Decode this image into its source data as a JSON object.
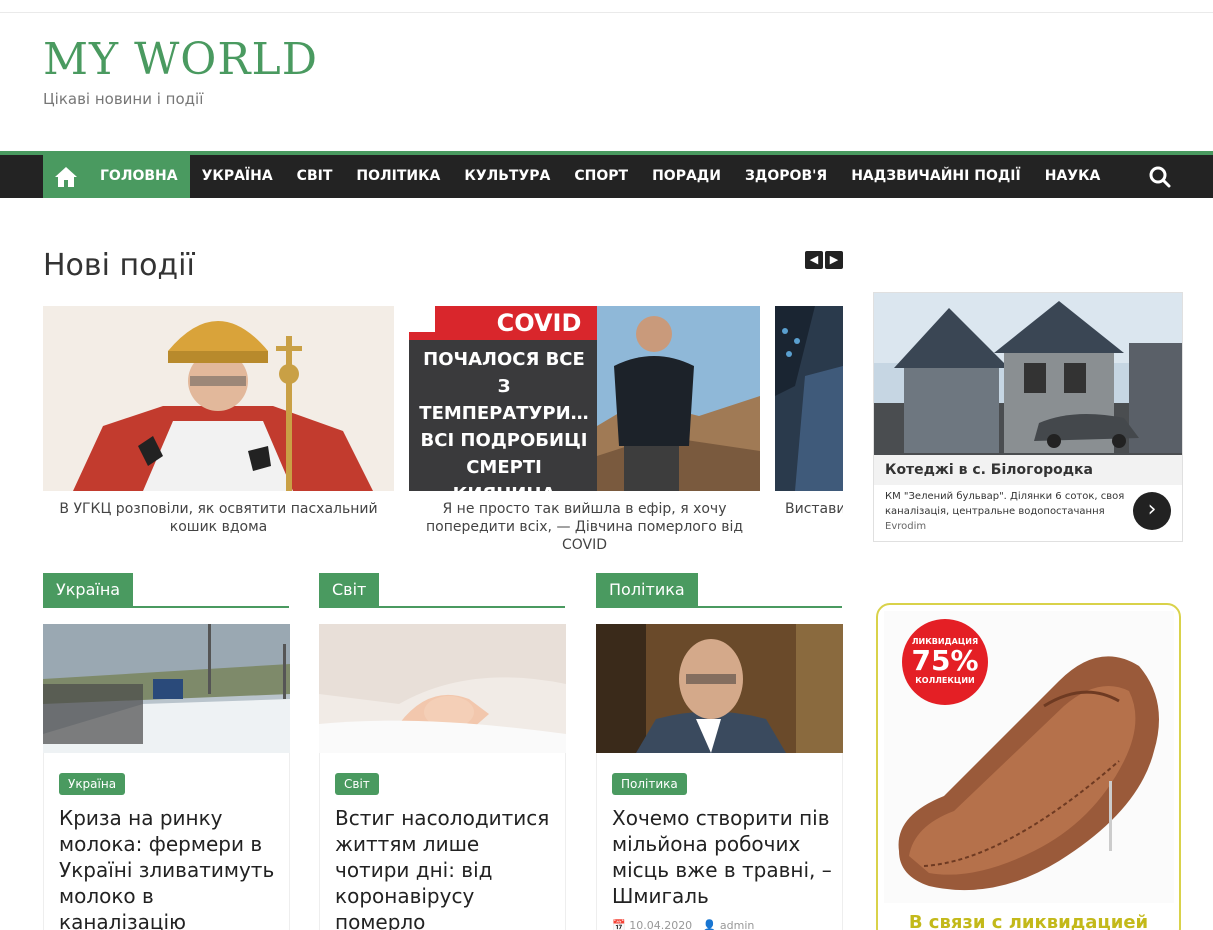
{
  "site": {
    "title": "MY WORLD",
    "description": "Цікаві новини і події"
  },
  "nav": {
    "items": [
      {
        "label": "ГОЛОВНА",
        "active": true
      },
      {
        "label": "УКРАЇНА"
      },
      {
        "label": "СВІТ"
      },
      {
        "label": "ПОЛІТИКА"
      },
      {
        "label": "КУЛЬТУРА"
      },
      {
        "label": "СПОРТ"
      },
      {
        "label": "ПОРАДИ"
      },
      {
        "label": "ЗДОРОВ'Я"
      },
      {
        "label": "НАДЗВИЧАЙНІ ПОДІЇ"
      },
      {
        "label": "НАУКА"
      }
    ],
    "accent": "#4a9a60"
  },
  "featured": {
    "title": "Нові події",
    "slides": [
      {
        "caption": "В УГКЦ розповіли, як освятити пасхальний кошик вдома"
      },
      {
        "caption": "Я не просто так вийшла в ефір, я хочу попередити всіх, — Дівчина померлого від COVID",
        "image_text": {
          "tag": "COVID",
          "headline": "ПОЧАЛОСЯ ВСЕ З ТЕМПЕРАТУРИ… ВСІ ПОДРОБИЦІ СМЕРТІ КИЯНИНА"
        }
      },
      {
        "caption": "Вистави"
      }
    ]
  },
  "categories": [
    {
      "tab": "Україна",
      "badge": "Україна",
      "title": "Криза на ринку молока: фермери в Україні зливатимуть молоко в каналізацію"
    },
    {
      "tab": "Світ",
      "badge": "Світ",
      "title": "Встиг насолодитися життям лише чотири дні: від коронавірусу померло новонароджене"
    },
    {
      "tab": "Політика",
      "badge": "Політика",
      "title": "Хочемо створити пів мільйона робочих місць вже в травні, – Шмигаль",
      "date": "10.04.2020",
      "author": "admin"
    }
  ],
  "ad1": {
    "title": "Котеджі в с. Білогородка",
    "text": "КМ \"Зелений бульвар\". Ділянки 6 соток, своя каналізація, центральне водопостачання",
    "source": "Evrodim"
  },
  "ad2": {
    "badge_top": "ЛИКВИДАЦИЯ",
    "badge_value": "75%",
    "badge_bottom": "КОЛЛЕКЦИИ",
    "text": "В связи с ликвидацией склада"
  }
}
